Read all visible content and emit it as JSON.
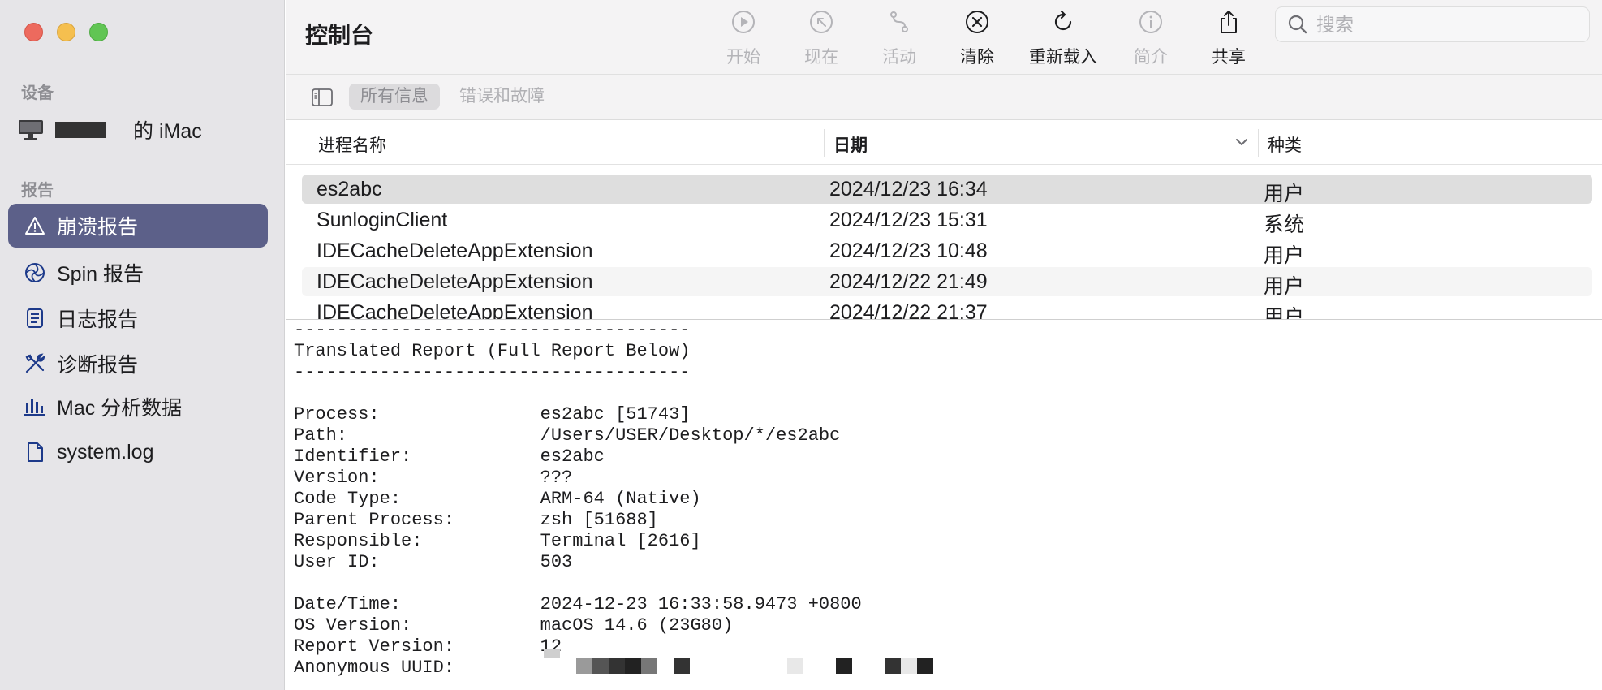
{
  "sidebar": {
    "device_section": "设备",
    "device_name": "的 iMac",
    "report_section": "报告",
    "items": [
      {
        "label": "崩溃报告",
        "icon": "warning-icon"
      },
      {
        "label": "Spin 报告",
        "icon": "spin-icon"
      },
      {
        "label": "日志报告",
        "icon": "document-icon"
      },
      {
        "label": "诊断报告",
        "icon": "tools-icon"
      },
      {
        "label": "Mac 分析数据",
        "icon": "chart-icon"
      },
      {
        "label": "system.log",
        "icon": "file-icon"
      }
    ]
  },
  "toolbar": {
    "title": "控制台",
    "start": "开始",
    "now": "现在",
    "activity": "活动",
    "clear": "清除",
    "reload": "重新载入",
    "info": "简介",
    "share": "共享"
  },
  "search": {
    "placeholder": "搜索"
  },
  "filter": {
    "all": "所有信息",
    "errors": "错误和故障"
  },
  "table": {
    "headers": {
      "process": "进程名称",
      "date": "日期",
      "kind": "种类"
    },
    "rows": [
      {
        "process": "es2abc",
        "date": "2024/12/23 16:34",
        "kind": "用户"
      },
      {
        "process": "SunloginClient",
        "date": "2024/12/23 15:31",
        "kind": "系统"
      },
      {
        "process": "IDECacheDeleteAppExtension",
        "date": "2024/12/23 10:48",
        "kind": "用户"
      },
      {
        "process": "IDECacheDeleteAppExtension",
        "date": "2024/12/22 21:49",
        "kind": "用户"
      },
      {
        "process": "IDECacheDeleteAppExtension",
        "date": "2024/12/22 21:37",
        "kind": "用户"
      }
    ]
  },
  "report": {
    "text": "-------------------------------------\nTranslated Report (Full Report Below)\n-------------------------------------\n\nProcess:               es2abc [51743]\nPath:                  /Users/USER/Desktop/*/es2abc\nIdentifier:            es2abc\nVersion:               ???\nCode Type:             ARM-64 (Native)\nParent Process:        zsh [51688]\nResponsible:           Terminal [2616]\nUser ID:               503\n\nDate/Time:             2024-12-23 16:33:58.9473 +0800\nOS Version:            macOS 14.6 (23G80)\nReport Version:        12\nAnonymous UUID:"
  }
}
